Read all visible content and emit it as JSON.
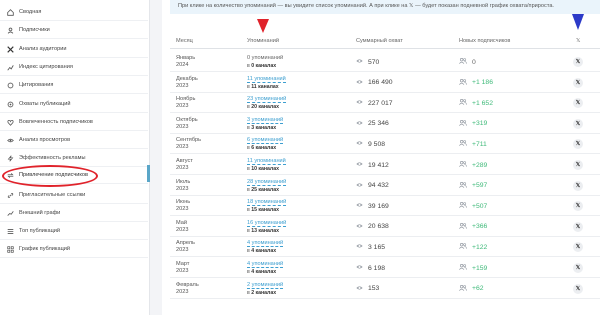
{
  "sidebar": {
    "items": [
      {
        "label": "Сводная",
        "icon": "home-icon"
      },
      {
        "label": "Подписчики",
        "icon": "user-icon"
      },
      {
        "label": "Анализ аудитории",
        "icon": "x-icon"
      },
      {
        "label": "Индекс цитирования",
        "icon": "chart-icon"
      },
      {
        "label": "Цитирования",
        "icon": "quote-icon"
      },
      {
        "label": "Охваты публикаций",
        "icon": "target-icon"
      },
      {
        "label": "Вовлеченность подписчиков",
        "icon": "heart-icon"
      },
      {
        "label": "Анализ просмотров",
        "icon": "eye-icon"
      },
      {
        "label": "Эффективность рекламы",
        "icon": "bolt-icon"
      },
      {
        "label": "Привлечение подписчиков",
        "icon": "arrows-icon"
      },
      {
        "label": "Пригласительные ссылки",
        "icon": "link-icon"
      },
      {
        "label": "Внешний графи",
        "icon": "trend-icon"
      },
      {
        "label": "Топ публикаций",
        "icon": "list-icon"
      },
      {
        "label": "График публикаций",
        "icon": "grid-icon"
      }
    ]
  },
  "hint": "При клике на количество упоминаний — вы увидите список упоминаний. А при клике на  𝕏  — будет показан подневной график охвата/прироста.",
  "columns": {
    "month": "Месяц",
    "mentions": "Упоминаний",
    "reach": "Суммарный охват",
    "subs": "Новых подписчиков",
    "x": "𝕏"
  },
  "rows": [
    {
      "month": "Январь",
      "year": "2024",
      "mentions": "0 упоминаний",
      "channels_pre": "в ",
      "channels": "0 каналах",
      "reach": "570",
      "subs": "0",
      "subs_zero": true,
      "mentions_zero": true
    },
    {
      "month": "Декабрь",
      "year": "2023",
      "mentions": "11 упоминаний",
      "channels_pre": "в ",
      "channels": "11 каналах",
      "reach": "166 490",
      "subs": "+1 186"
    },
    {
      "month": "Ноябрь",
      "year": "2023",
      "mentions": "23 упоминаний",
      "channels_pre": "в ",
      "channels": "20 каналах",
      "reach": "227 017",
      "subs": "+1 652"
    },
    {
      "month": "Октябрь",
      "year": "2023",
      "mentions": "3 упоминаний",
      "channels_pre": "в ",
      "channels": "3 каналах",
      "reach": "25 346",
      "subs": "+319"
    },
    {
      "month": "Сентябрь",
      "year": "2023",
      "mentions": "6 упоминаний",
      "channels_pre": "в ",
      "channels": "6 каналах",
      "reach": "9 508",
      "subs": "+711"
    },
    {
      "month": "Август",
      "year": "2023",
      "mentions": "11 упоминаний",
      "channels_pre": "в ",
      "channels": "10 каналах",
      "reach": "19 412",
      "subs": "+289"
    },
    {
      "month": "Июль",
      "year": "2023",
      "mentions": "28 упоминаний",
      "channels_pre": "в ",
      "channels": "25 каналах",
      "reach": "94 432",
      "subs": "+597"
    },
    {
      "month": "Июнь",
      "year": "2023",
      "mentions": "18 упоминаний",
      "channels_pre": "в ",
      "channels": "15 каналах",
      "reach": "39 169",
      "subs": "+507"
    },
    {
      "month": "Май",
      "year": "2023",
      "mentions": "16 упоминаний",
      "channels_pre": "в ",
      "channels": "13 каналах",
      "reach": "20 638",
      "subs": "+366"
    },
    {
      "month": "Апрель",
      "year": "2023",
      "mentions": "4 упоминаний",
      "channels_pre": "в ",
      "channels": "4 каналах",
      "reach": "3 165",
      "subs": "+122"
    },
    {
      "month": "Март",
      "year": "2023",
      "mentions": "4 упоминаний",
      "channels_pre": "в ",
      "channels": "4 каналах",
      "reach": "6 198",
      "subs": "+159"
    },
    {
      "month": "Февраль",
      "year": "2023",
      "mentions": "2 упоминаний",
      "channels_pre": "в ",
      "channels": "2 каналах",
      "reach": "153",
      "subs": "+62"
    }
  ],
  "colors": {
    "accent": "#3d9fd0",
    "positive": "#3fba7a",
    "annotation_red": "#e0232b",
    "annotation_blue": "#2c3ac8"
  }
}
